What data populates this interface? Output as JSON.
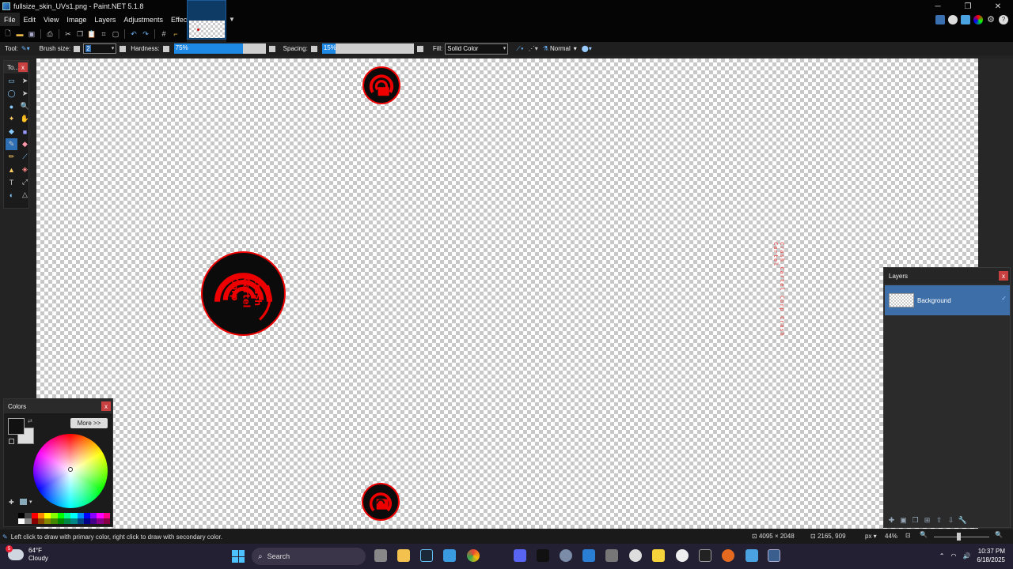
{
  "window": {
    "title": "fullsize_skin_UVs1.png - Paint.NET 5.1.8",
    "minimize": "─",
    "maximize": "❐",
    "close": "✕"
  },
  "menu": [
    "File",
    "Edit",
    "View",
    "Image",
    "Layers",
    "Adjustments",
    "Effects"
  ],
  "toolbar": {
    "tool_label": "Tool:",
    "brush_size_label": "Brush size:",
    "brush_size_value": "2",
    "hardness_label": "Hardness:",
    "hardness_value": "75%",
    "hardness_fraction": 0.75,
    "spacing_label": "Spacing:",
    "spacing_value": "15%",
    "spacing_fraction": 0.15,
    "fill_label": "Fill:",
    "fill_value": "Solid Color",
    "blend_mode": "Normal"
  },
  "tools_panel": {
    "title": "To...",
    "close": "x"
  },
  "colors_panel": {
    "title": "Colors",
    "close": "x",
    "more_button": "More >>",
    "primary_color": "#111111",
    "secondary_color": "#dddddd"
  },
  "layers_panel": {
    "title": "Layers",
    "close": "x",
    "layers": [
      {
        "name": "Background",
        "visible": true
      }
    ]
  },
  "canvas": {
    "emblem_text": [
      "Crash",
      "Cartel",
      "Corp"
    ],
    "vertical_text": "Crash Cartel Corp Crash Cartel",
    "accent_color": "#e00000"
  },
  "status": {
    "hint": "Left click to draw with primary color, right click to draw with secondary color.",
    "image_size": "4095 × 2048",
    "cursor_pos": "2165, 909",
    "unit": "px",
    "zoom": "44%"
  },
  "taskbar": {
    "weather_temp": "64°F",
    "weather_desc": "Cloudy",
    "weather_badge": "5",
    "search_placeholder": "Search",
    "time": "10:37 PM",
    "date": "6/18/2025"
  }
}
